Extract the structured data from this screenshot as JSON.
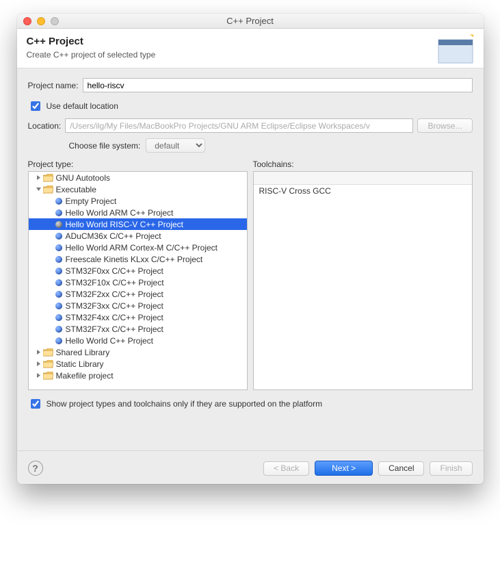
{
  "window_title": "C++ Project",
  "header": {
    "title": "C++ Project",
    "subtitle": "Create C++ project of selected type"
  },
  "form": {
    "project_name_label": "Project name:",
    "project_name_value": "hello-riscv",
    "use_default_label": "Use default location",
    "use_default_checked": true,
    "location_label": "Location:",
    "location_value": "/Users/ilg/My Files/MacBookPro Projects/GNU ARM Eclipse/Eclipse Workspaces/v",
    "browse_label": "Browse...",
    "choose_fs_label": "Choose file system:",
    "choose_fs_value": "default",
    "show_supported_label": "Show project types and toolchains only if they are supported on the platform",
    "show_supported_checked": true
  },
  "columns": {
    "project_type_label": "Project type:",
    "toolchains_label": "Toolchains:"
  },
  "tree": [
    {
      "depth": 0,
      "arrow": "right",
      "icon": "folder",
      "label": "GNU Autotools",
      "sel": false
    },
    {
      "depth": 0,
      "arrow": "down",
      "icon": "folder",
      "label": "Executable",
      "sel": false
    },
    {
      "depth": 1,
      "arrow": "none",
      "icon": "dot",
      "label": "Empty Project",
      "sel": false
    },
    {
      "depth": 1,
      "arrow": "none",
      "icon": "dot",
      "label": "Hello World ARM C++ Project",
      "sel": false
    },
    {
      "depth": 1,
      "arrow": "none",
      "icon": "dotgrey",
      "label": "Hello World RISC-V C++ Project",
      "sel": true
    },
    {
      "depth": 1,
      "arrow": "none",
      "icon": "dot",
      "label": "ADuCM36x C/C++ Project",
      "sel": false
    },
    {
      "depth": 1,
      "arrow": "none",
      "icon": "dot",
      "label": "Hello World ARM Cortex-M C/C++ Project",
      "sel": false
    },
    {
      "depth": 1,
      "arrow": "none",
      "icon": "dot",
      "label": "Freescale Kinetis KLxx C/C++ Project",
      "sel": false
    },
    {
      "depth": 1,
      "arrow": "none",
      "icon": "dot",
      "label": "STM32F0xx C/C++ Project",
      "sel": false
    },
    {
      "depth": 1,
      "arrow": "none",
      "icon": "dot",
      "label": "STM32F10x C/C++ Project",
      "sel": false
    },
    {
      "depth": 1,
      "arrow": "none",
      "icon": "dot",
      "label": "STM32F2xx C/C++ Project",
      "sel": false
    },
    {
      "depth": 1,
      "arrow": "none",
      "icon": "dot",
      "label": "STM32F3xx C/C++ Project",
      "sel": false
    },
    {
      "depth": 1,
      "arrow": "none",
      "icon": "dot",
      "label": "STM32F4xx C/C++ Project",
      "sel": false
    },
    {
      "depth": 1,
      "arrow": "none",
      "icon": "dot",
      "label": "STM32F7xx C/C++ Project",
      "sel": false
    },
    {
      "depth": 1,
      "arrow": "none",
      "icon": "dot",
      "label": "Hello World C++ Project",
      "sel": false
    },
    {
      "depth": 0,
      "arrow": "right",
      "icon": "folder",
      "label": "Shared Library",
      "sel": false
    },
    {
      "depth": 0,
      "arrow": "right",
      "icon": "folder",
      "label": "Static Library",
      "sel": false
    },
    {
      "depth": 0,
      "arrow": "right",
      "icon": "folder",
      "label": "Makefile project",
      "sel": false
    }
  ],
  "toolchains": [
    "RISC-V Cross GCC"
  ],
  "buttons": {
    "back": "< Back",
    "next": "Next >",
    "cancel": "Cancel",
    "finish": "Finish"
  }
}
